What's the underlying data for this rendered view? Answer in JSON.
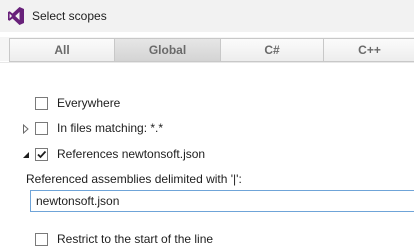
{
  "window": {
    "title": "Select scopes",
    "icon": "visual-studio-logo-icon"
  },
  "tabs": [
    {
      "label": "All",
      "active": false
    },
    {
      "label": "Global",
      "active": true
    },
    {
      "label": "C#",
      "active": false
    },
    {
      "label": "C++",
      "active": false
    }
  ],
  "options": {
    "everywhere": {
      "label": "Everywhere",
      "checked": false
    },
    "in_files_matching": {
      "label": "In files matching: *.*",
      "checked": false,
      "expander": "collapsed"
    },
    "references": {
      "label": "References newtonsoft.json",
      "checked": true,
      "expander": "expanded"
    }
  },
  "assemblies": {
    "label": "Referenced assemblies delimited with '|':",
    "value": "newtonsoft.json"
  },
  "restrict": {
    "label": "Restrict to the start of the line",
    "checked": false
  },
  "colors": {
    "accent": "#6fa4d8",
    "logo": "#68217a"
  }
}
